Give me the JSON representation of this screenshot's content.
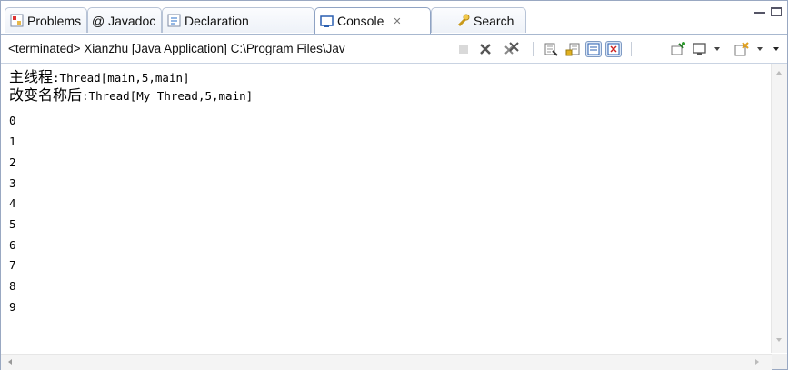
{
  "tabs": [
    {
      "label": "Problems",
      "icon": "problems-icon",
      "active": false
    },
    {
      "label": "@ Javadoc",
      "icon": "javadoc-icon",
      "active": false
    },
    {
      "label": "Declaration",
      "icon": "declaration-icon",
      "active": false
    },
    {
      "label": "Console",
      "icon": "console-icon",
      "active": true,
      "close": "✕"
    },
    {
      "label": "Search",
      "icon": "search-icon",
      "active": false
    }
  ],
  "toolbar": {
    "status": "<terminated> Xianzhu [Java Application] C:\\Program Files\\Jav"
  },
  "console": {
    "lines": [
      {
        "cjk": "主线程",
        "text": ":Thread[main,5,main]"
      },
      {
        "cjk": "改变名称后",
        "text": ":Thread[My Thread,5,main]"
      },
      {
        "cjk": "",
        "text": "0"
      },
      {
        "cjk": "",
        "text": "1"
      },
      {
        "cjk": "",
        "text": "2"
      },
      {
        "cjk": "",
        "text": "3"
      },
      {
        "cjk": "",
        "text": "4"
      },
      {
        "cjk": "",
        "text": "5"
      },
      {
        "cjk": "",
        "text": "6"
      },
      {
        "cjk": "",
        "text": "7"
      },
      {
        "cjk": "",
        "text": "8"
      },
      {
        "cjk": "",
        "text": "9"
      }
    ]
  },
  "colors": {
    "accent": "#8fa3c4",
    "border": "#99a8c2"
  }
}
